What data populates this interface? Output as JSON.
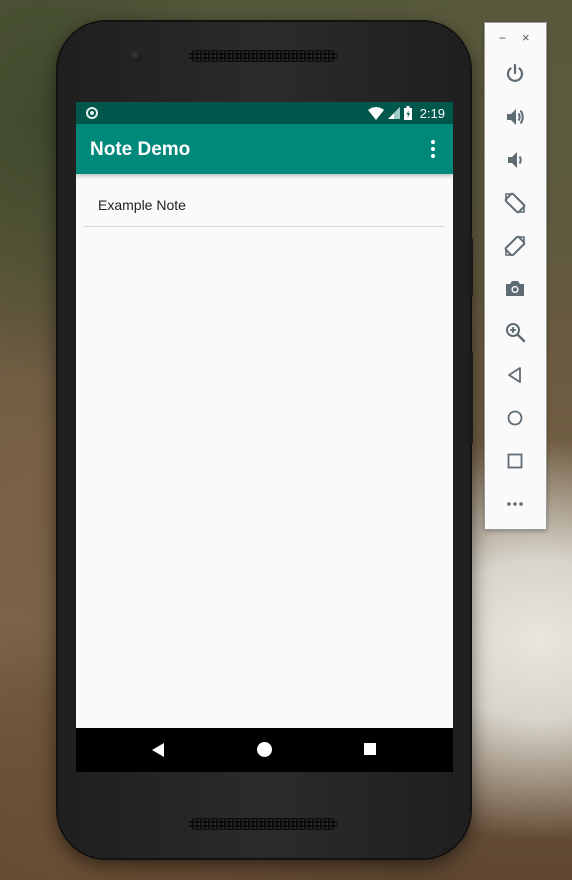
{
  "status_bar": {
    "time": "2:19",
    "icons": [
      "notification-dot-icon",
      "wifi-icon",
      "signal-icon",
      "battery-icon"
    ]
  },
  "app_bar": {
    "title": "Note Demo",
    "overflow_icon": "more-vert-icon"
  },
  "notes": [
    {
      "label": "Example Note"
    }
  ],
  "nav_bar": {
    "icons": [
      "back-icon",
      "home-icon",
      "recents-icon"
    ]
  },
  "emulator_toolbar": {
    "window_buttons": {
      "minimize": "−",
      "close": "×"
    },
    "tools": [
      "power-icon",
      "volume-up-icon",
      "volume-down-icon",
      "rotate-left-icon",
      "rotate-right-icon",
      "screenshot-icon",
      "zoom-icon",
      "back-icon",
      "home-icon",
      "overview-icon",
      "more-icon"
    ]
  },
  "colors": {
    "status_bar": "#00574b",
    "app_bar": "#00897b",
    "screen_background": "#fafafa",
    "toolbar_icon": "#5f6b73"
  }
}
